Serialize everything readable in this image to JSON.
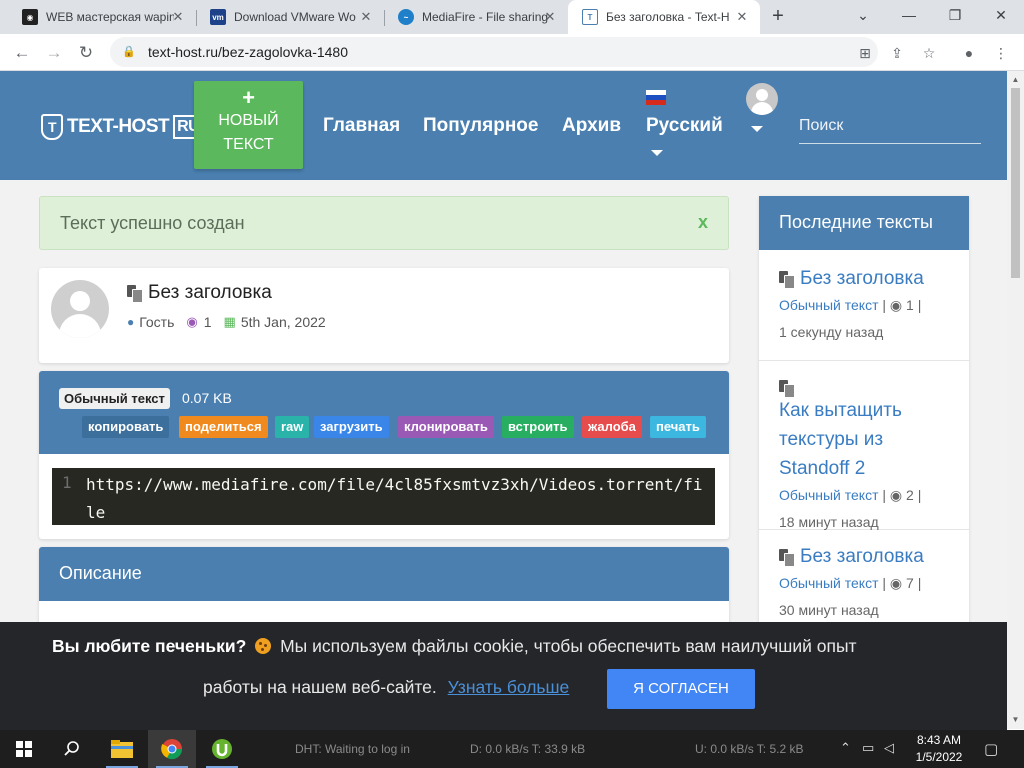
{
  "browser": {
    "tabs": [
      {
        "title": "WEB мастерская wapin",
        "active": false,
        "favicon_color": "#222222"
      },
      {
        "title": "Download VMware Wo",
        "active": false,
        "favicon_color": "#1d428a"
      },
      {
        "title": "MediaFire - File sharing",
        "active": false,
        "favicon_color": "#1f80c9"
      },
      {
        "title": "Без заголовка - Text-H",
        "active": true,
        "favicon_color": "#4a7fb0"
      }
    ],
    "url": "text-host.ru/bez-zagolovka-1480"
  },
  "site": {
    "logo_text": "TEXT-HOST",
    "logo_suffix": "RU",
    "new_text_plus": "+",
    "new_text_label": "НОВЫЙ ТЕКСТ",
    "nav": [
      "Главная",
      "Популярное",
      "Архив",
      "Русский"
    ],
    "search_placeholder": "Поиск",
    "colors": {
      "header": "#4a7fb0",
      "success": "#5cb85c",
      "link": "#3a7cc1"
    }
  },
  "alert": {
    "message": "Текст успешно создан",
    "close": "x"
  },
  "paste": {
    "title": "Без заголовка",
    "author": "Гость",
    "views": "1",
    "date": "5th Jan, 2022",
    "syntax": "Обычный текст",
    "size": "0.07 KB",
    "actions": [
      {
        "label": "копировать",
        "color": "#3d6f9c"
      },
      {
        "label": "поделиться",
        "color": "#f0891e"
      },
      {
        "label": "raw",
        "color": "#2ab3a9"
      },
      {
        "label": "загрузить",
        "color": "#3a86e8"
      },
      {
        "label": "клонировать",
        "color": "#9b59b6"
      },
      {
        "label": "встроить",
        "color": "#27ae60"
      },
      {
        "label": "жалоба",
        "color": "#e74c4c"
      },
      {
        "label": "печать",
        "color": "#3cb8e0"
      }
    ],
    "line_number": "1",
    "content": "https://www.mediafire.com/file/4cl85fxsmtvz3xh/Videos.torrent/file"
  },
  "description": {
    "heading": "Описание"
  },
  "sidebar": {
    "heading": "Последние тексты",
    "items": [
      {
        "title": "Без заголовка",
        "type": "Обычный текст",
        "views": "1",
        "time": "1 секунду назад"
      },
      {
        "title": "Как вытащить текстуры из Standoff 2",
        "type": "Обычный текст",
        "views": "2",
        "time": "18 минут назад"
      },
      {
        "title": "Без заголовка",
        "type": "Обычный текст",
        "views": "7",
        "time": "30 минут назад"
      }
    ]
  },
  "cookie": {
    "title": "Вы любите печеньки?",
    "text_1": "Мы используем файлы cookie, чтобы обеспечить вам наилучший опыт",
    "text_2": "работы на нашем веб-сайте.",
    "link": "Узнать больше",
    "button": "Я СОГЛАСЕН"
  },
  "taskbar": {
    "status_dht": "DHT: Waiting to log in",
    "status_down": "D: 0.0 kB/s T: 33.9 kB",
    "status_up": "U: 0.0 kB/s T: 5.2 kB",
    "time": "8:43 AM",
    "date": "1/5/2022"
  }
}
